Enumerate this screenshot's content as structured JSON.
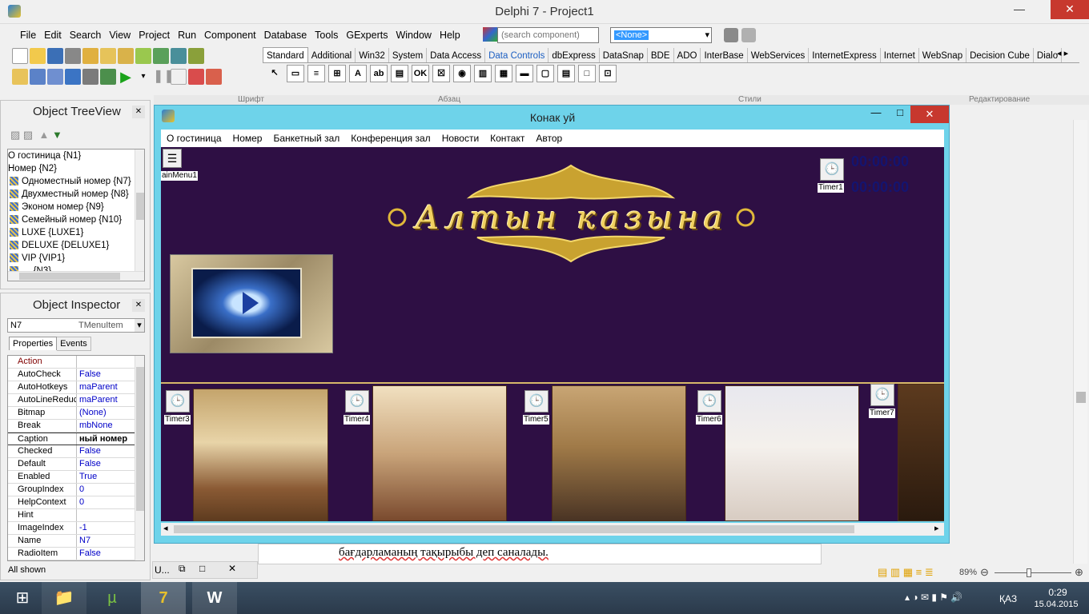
{
  "window": {
    "title": "Delphi 7 - Project1",
    "minimize": "—",
    "maximize": "□",
    "close": "✕"
  },
  "menu": [
    "File",
    "Edit",
    "Search",
    "View",
    "Project",
    "Run",
    "Component",
    "Database",
    "Tools",
    "GExperts",
    "Window",
    "Help"
  ],
  "search": {
    "placeholder": "(search component)"
  },
  "config_combo": {
    "value": "<None>"
  },
  "palette_tabs": [
    "Standard",
    "Additional",
    "Win32",
    "System",
    "Data Access",
    "Data Controls",
    "dbExpress",
    "DataSnap",
    "BDE",
    "ADO",
    "InterBase",
    "WebServices",
    "InternetExpress",
    "Internet",
    "WebSnap",
    "Decision Cube",
    "Dialo"
  ],
  "palette_icons": [
    "↖",
    "▭",
    "≡",
    "⊞",
    "A",
    "ab",
    "▤",
    "OK",
    "☒",
    "◉",
    "▥",
    "▦",
    "▬",
    "▢",
    "▤",
    "□",
    "⊡"
  ],
  "ruler_labels": [
    "Шрифт",
    "Абзац",
    "Стили",
    "Редактирование"
  ],
  "treeview": {
    "title": "Object TreeView",
    "items": [
      "О гостиница {N1}",
      "Номер {N2}",
      "Одноместный номер {N7}",
      "Двухместный номер  {N8}",
      "Эконом номер {N9}",
      "Семейный номер {N10}",
      "LUXE {LUXE1}",
      "DELUXE {DELUXE1}",
      "VIP {VIP1}",
      "… {N3}"
    ]
  },
  "inspector": {
    "title": "Object Inspector",
    "object_name": "N7",
    "object_type": "TMenuItem",
    "tabs": [
      "Properties",
      "Events"
    ],
    "rows": [
      {
        "name": "Action",
        "value": ""
      },
      {
        "name": "AutoCheck",
        "value": "False"
      },
      {
        "name": "AutoHotkeys",
        "value": "maParent"
      },
      {
        "name": "AutoLineReduc",
        "value": "maParent"
      },
      {
        "name": "Bitmap",
        "value": "(None)"
      },
      {
        "name": "Break",
        "value": "mbNone"
      },
      {
        "name": "Caption",
        "value": "ный номер"
      },
      {
        "name": "Checked",
        "value": "False"
      },
      {
        "name": "Default",
        "value": "False"
      },
      {
        "name": "Enabled",
        "value": "True"
      },
      {
        "name": "GroupIndex",
        "value": "0"
      },
      {
        "name": "HelpContext",
        "value": "0"
      },
      {
        "name": "Hint",
        "value": ""
      },
      {
        "name": "ImageIndex",
        "value": "-1"
      },
      {
        "name": "Name",
        "value": "N7"
      },
      {
        "name": "RadioItem",
        "value": "False"
      }
    ],
    "footer": "All shown"
  },
  "form": {
    "title": "Конак уй",
    "menu": [
      "О гостиница",
      "Номер",
      "Банкетный зал",
      "Конференция зал",
      "Новости",
      "Контакт",
      "Автор"
    ],
    "mainmenu_label": "ainMenu1",
    "banner_text": "Алтын казына",
    "clock1": "00:00:00",
    "clock2": "00:00:00",
    "timers": [
      "Timer1",
      "Timer3",
      "Timer4",
      "Timer5",
      "Timer6",
      "Timer7"
    ]
  },
  "minimized": {
    "label": "U..."
  },
  "doc_text": "бағдарламаның тақырыбы деп саналады.",
  "zoom": "89%",
  "tray": {
    "lang": "ҚАЗ",
    "time": "0:29",
    "date": "15.04.2015"
  },
  "colors": {
    "form_frame": "#6ed3ea",
    "purple": "#3c175b",
    "gold": "#e0b83a"
  }
}
